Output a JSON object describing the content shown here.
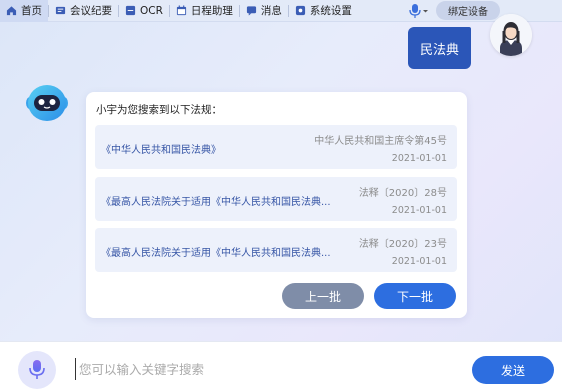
{
  "nav": {
    "items": [
      {
        "label": "首页",
        "icon": "home-icon"
      },
      {
        "label": "会议纪要",
        "icon": "meeting-icon"
      },
      {
        "label": "OCR",
        "icon": "ocr-icon"
      },
      {
        "label": "日程助理",
        "icon": "calendar-icon"
      },
      {
        "label": "消息",
        "icon": "message-icon"
      },
      {
        "label": "系统设置",
        "icon": "settings-icon"
      }
    ],
    "bind_device_label": "绑定设备"
  },
  "chat": {
    "user_message": "民法典",
    "bot_intro": "小宇为您搜索到以下法规：",
    "results": [
      {
        "name": "《中华人民共和国民法典》",
        "doc_no": "中华人民共和国主席令第45号",
        "date": "2021-01-01"
      },
      {
        "name": "《最高人民法院关于适用《中华人民共和国民法典...",
        "doc_no": "法释〔2020〕28号",
        "date": "2021-01-01"
      },
      {
        "name": "《最高人民法院关于适用《中华人民共和国民法典...",
        "doc_no": "法释〔2020〕23号",
        "date": "2021-01-01"
      }
    ],
    "prev_label": "上一批",
    "next_label": "下一批"
  },
  "input": {
    "placeholder": "您可以输入关键字搜索",
    "value": "",
    "send_label": "发送"
  },
  "colors": {
    "accent": "#2d6ee0",
    "user_bubble": "#2b56b8",
    "secondary_button": "#7f8da8"
  }
}
